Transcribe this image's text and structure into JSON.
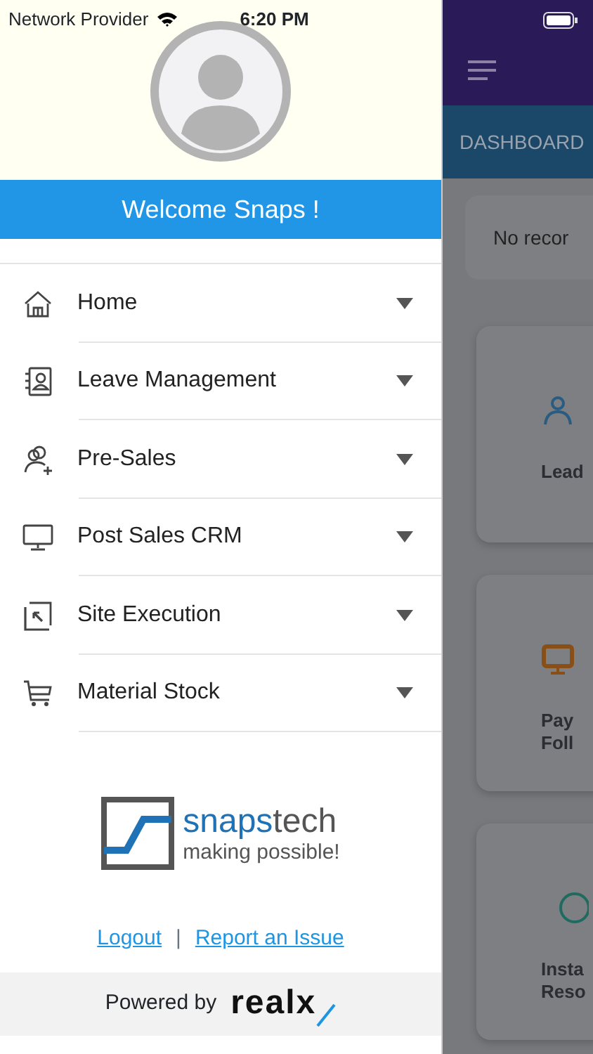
{
  "status_bar": {
    "carrier": "Network Provider",
    "time": "6:20 PM"
  },
  "drawer": {
    "welcome": "Welcome Snaps !",
    "menu": [
      {
        "label": "Home"
      },
      {
        "label": "Leave Management"
      },
      {
        "label": "Pre-Sales"
      },
      {
        "label": "Post Sales CRM"
      },
      {
        "label": "Site Execution"
      },
      {
        "label": "Material Stock"
      }
    ],
    "logo": {
      "name_part_1": "snaps",
      "name_part_2": "tech",
      "tagline": "making possible!"
    },
    "links": [
      "Logout",
      "Report an Issue"
    ],
    "separator": "|",
    "footer": {
      "text": "Powered by",
      "brand": "realx"
    }
  },
  "background_app": {
    "tab": "DASHBOARD",
    "notice": "No recor",
    "cards": [
      {
        "lines": [
          "Lead"
        ],
        "color": "#2a5b80"
      },
      {
        "lines": [
          "Pay",
          "Foll"
        ],
        "color": "#8a4e17"
      },
      {
        "lines": [
          "Insta",
          "Reso"
        ],
        "color": "#1f6b60"
      }
    ]
  }
}
